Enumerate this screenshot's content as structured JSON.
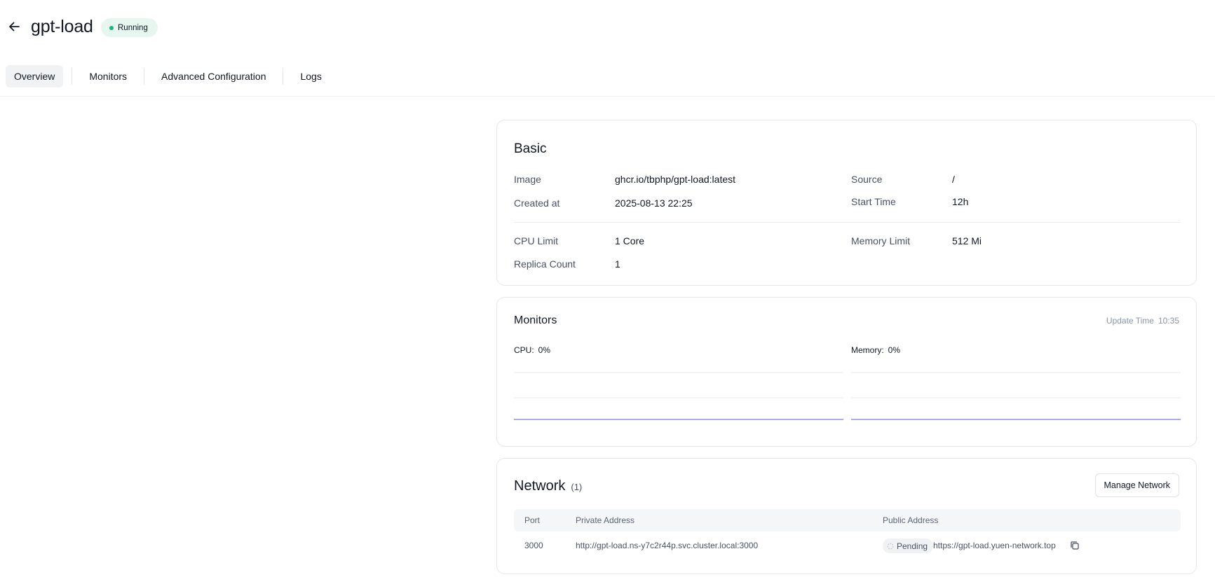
{
  "header": {
    "title": "gpt-load",
    "status": "Running"
  },
  "tabs": [
    {
      "label": "Overview",
      "active": true
    },
    {
      "label": "Monitors",
      "active": false
    },
    {
      "label": "Advanced Configuration",
      "active": false
    },
    {
      "label": "Logs",
      "active": false
    }
  ],
  "basic": {
    "title": "Basic",
    "image_label": "Image",
    "image_value": "ghcr.io/tbphp/gpt-load:latest",
    "source_label": "Source",
    "source_value": "/",
    "created_label": "Created at",
    "created_value": "2025-08-13 22:25",
    "start_label": "Start Time",
    "start_value": "12h",
    "cpu_label": "CPU Limit",
    "cpu_value": "1 Core",
    "memory_label": "Memory Limit",
    "memory_value": "512 Mi",
    "replica_label": "Replica Count",
    "replica_value": "1"
  },
  "monitors": {
    "title": "Monitors",
    "update_label": "Update Time",
    "update_value": "10:35",
    "cpu_label": "CPU:",
    "cpu_value": "0%",
    "memory_label": "Memory:",
    "memory_value": "0%",
    "line_color": "#8b8ff0"
  },
  "network": {
    "title": "Network",
    "count": "(1)",
    "manage_label": "Manage Network",
    "columns": [
      "Port",
      "Private Address",
      "Public Address"
    ],
    "rows": [
      {
        "port": "3000",
        "private": "http://gpt-load.ns-y7c2r44p.svc.cluster.local:3000",
        "status": "Pending",
        "public": "https://gpt-load.yuen-network.top"
      }
    ]
  },
  "colors": {
    "running_dot": "#11b981",
    "running_bg": "#e7f6ef"
  }
}
